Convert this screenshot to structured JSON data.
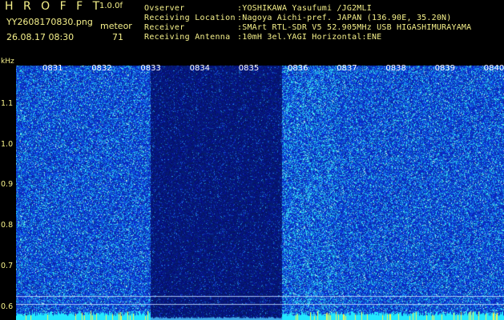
{
  "header": {
    "brand": "H R O F F T",
    "version": "1.0.0f",
    "filename": "YY2608170830.png",
    "timestamp": "26.08.17 08:30",
    "event_type": "meteor",
    "event_count": "71",
    "info": [
      {
        "label": "Ovserver",
        "value": ":YOSHIKAWA Yasufumi /JG2MLI"
      },
      {
        "label": "Receiving Location",
        "value": ":Nagoya Aichi-pref. JAPAN (136.90E, 35.20N)"
      },
      {
        "label": "Receiver",
        "value": ":SMArt RTL-SDR V5 52.905MHz USB HIGASHIMURAYAMA"
      },
      {
        "label": "Receiving Antenna",
        "value": ":10mH 3el.YAGI Horizontal:ENE"
      }
    ]
  },
  "chart_data": {
    "type": "heatmap",
    "title": "",
    "ylabel": "kHz",
    "y_ticks": [
      "1.1",
      "1.0",
      "0.9",
      "0.8",
      "0.7",
      "0.6"
    ],
    "y_values": [
      1.1,
      1.0,
      0.9,
      0.8,
      0.7,
      0.6
    ],
    "x_ticks": [
      "0831",
      "0832",
      "0833",
      "0834",
      "0835",
      "0836",
      "0837",
      "0838",
      "0839",
      "0840"
    ],
    "ylim": [
      0.57,
      1.2
    ],
    "dark_band": {
      "from": "0833",
      "to": "0836"
    },
    "colors": {
      "background": "#000000",
      "noise": "#1a2cc8",
      "dark": "#050a70",
      "strong": "#22e8ff",
      "text": "#f5f08a"
    }
  }
}
